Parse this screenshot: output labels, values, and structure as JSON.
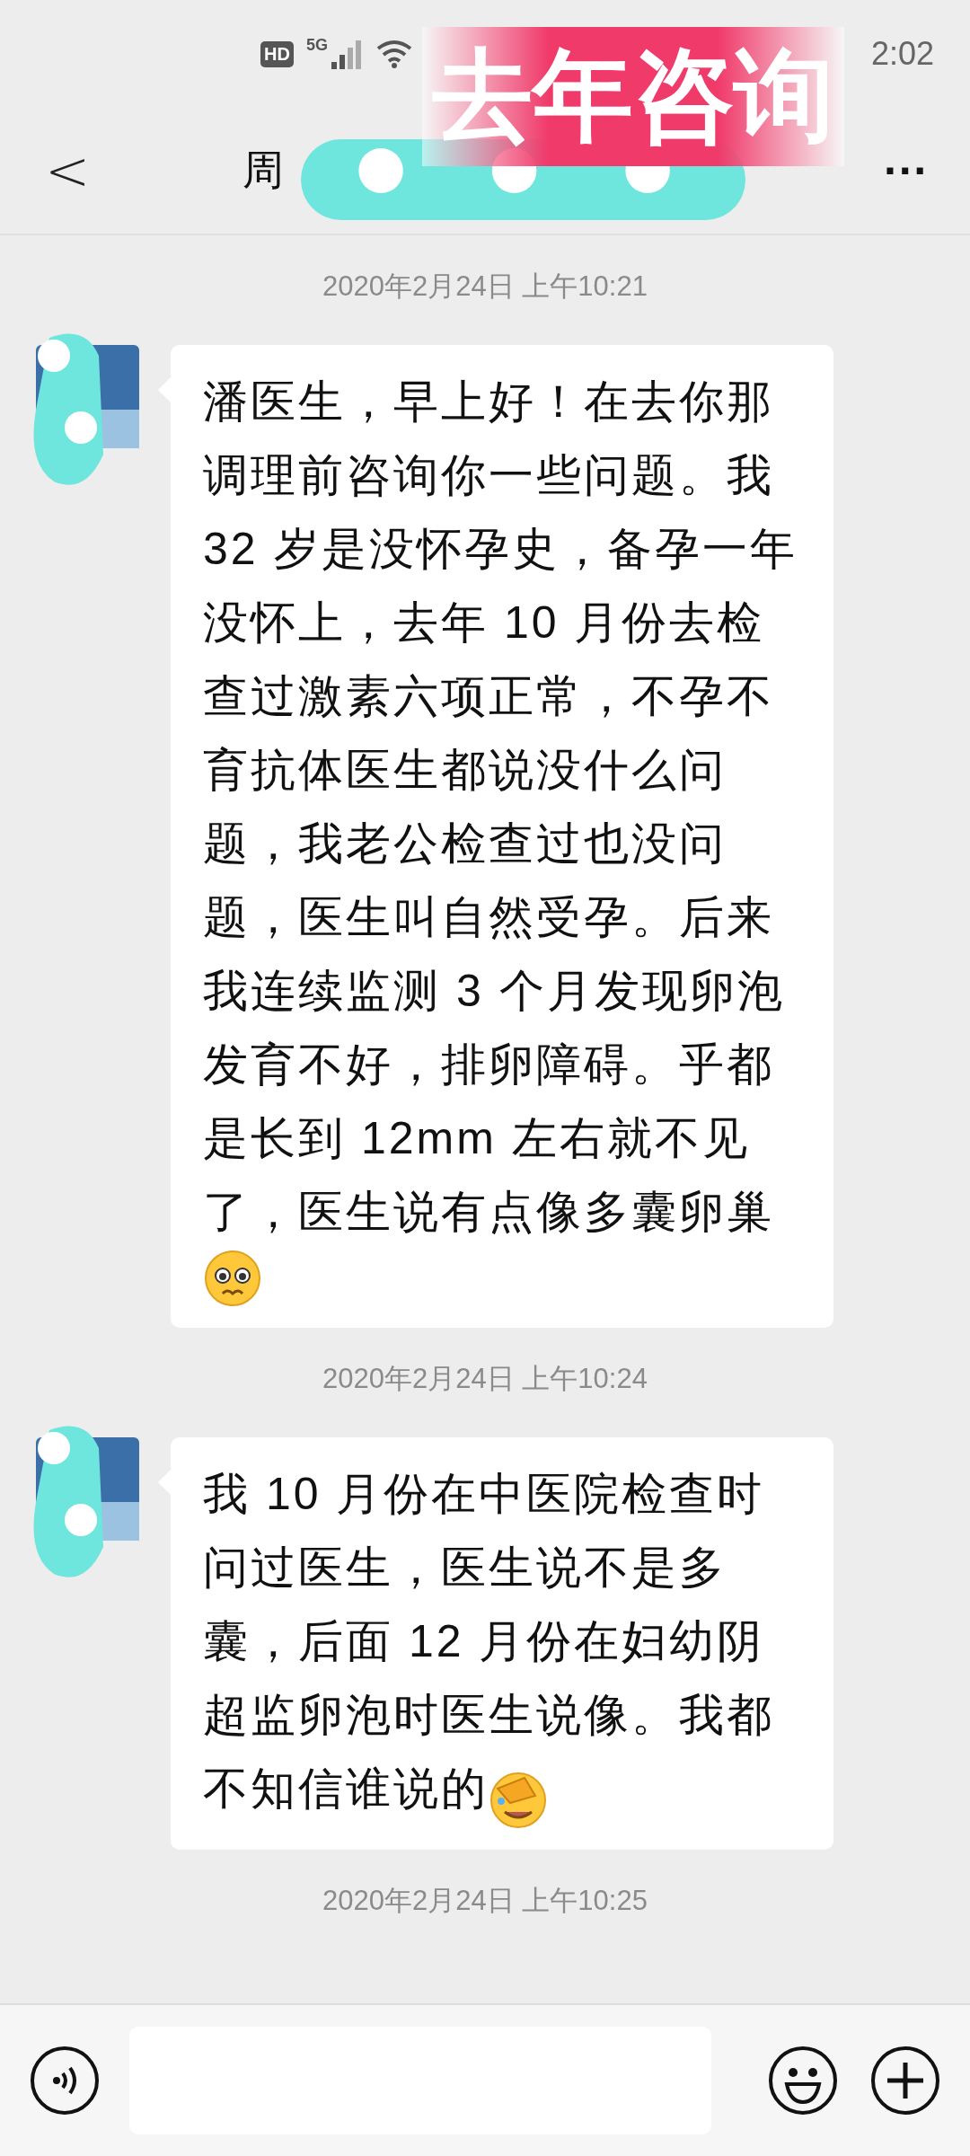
{
  "status_bar": {
    "network_badge": "HD",
    "network_type": "5G",
    "time": "2:02"
  },
  "overlay_banner": {
    "text": "去年咨询"
  },
  "header": {
    "back": "<",
    "title": "周",
    "more": "···"
  },
  "messages": [
    {
      "timestamp": "2020年2月24日 上午10:21",
      "text": "潘医生，早上好！在去你那调理前咨询你一些问题。我 32 岁是没怀孕史，备孕一年没怀上，去年 10 月份去检查过激素六项正常，不孕不育抗体医生都说没什么问题，我老公检查过也没问题，医生叫自然受孕。后来我连续监测 3 个月发现卵泡发育不好，排卵障碍。乎都是长到 12mm 左右就不见了，医生说有点像多囊卵巢",
      "kind": "worried"
    },
    {
      "timestamp": "2020年2月24日 上午10:24",
      "text": "我 10 月份在中医院检查时问过医生，医生说不是多囊，后面 12 月份在妇幼阴超监卵泡时医生说像。我都不知信谁说的",
      "kind": "facepalm"
    },
    {
      "timestamp": "2020年2月24日 上午10:25"
    }
  ]
}
